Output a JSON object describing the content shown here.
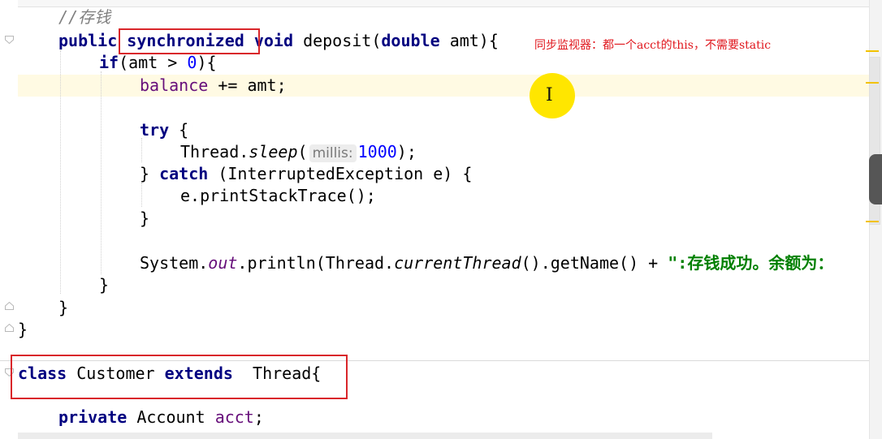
{
  "code": {
    "comment": "//存钱",
    "l_public": "public",
    "l_synchronized": "synchronized",
    "l_void": "void",
    "l_deposit": "deposit(",
    "l_double": "double",
    "l_amt_open": "amt){",
    "l_if": "if",
    "l_if_cond": "(amt > ",
    "l_zero": "0",
    "l_if_close": "){",
    "l_balance": "balance",
    "l_balance_rest": " += amt;",
    "l_try": "try",
    "l_try_brace": " {",
    "l_thread": "Thread.",
    "l_sleep": "sleep",
    "l_sleep_open": "(",
    "hint_millis": "millis:",
    "l_1000": "1000",
    "l_sleep_close": ");",
    "l_brace_close": "}",
    "l_catch": "catch",
    "l_catch_rest": " (InterruptedException e) {",
    "l_print_stack": "e.printStackTrace();",
    "l_system": "System.",
    "l_out": "out",
    "l_println": ".println(Thread.",
    "l_current": "currentThread",
    "l_getname": "().getName() + ",
    "l_string": "\":存钱成功。余额为：",
    "l_class": "class",
    "l_customer": "Customer",
    "l_extends": "extends",
    "l_thread_super": "Thread{",
    "l_private": "private",
    "l_account": "Account",
    "l_acct": "acct",
    "l_semicolon": ";"
  },
  "annotation": {
    "note": "同步监视器：都一个acct的this，不需要static"
  },
  "colors": {
    "keyword": "#000080",
    "field": "#660e7a",
    "number": "#0000ff",
    "string": "#008000",
    "comment": "#808080",
    "highlight_box": "#d9262a",
    "cursor_marker": "#ffe600"
  }
}
